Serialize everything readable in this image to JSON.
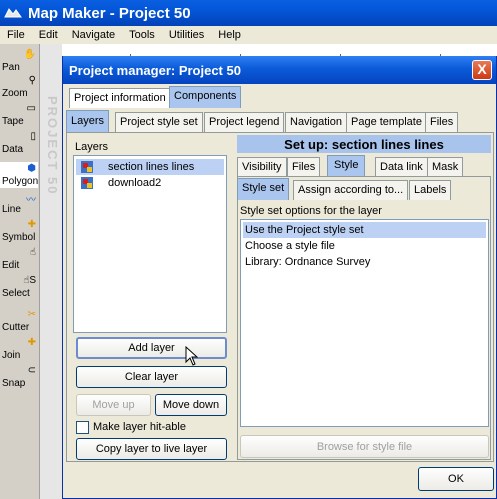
{
  "app": {
    "title": "Map Maker - Project 50",
    "menu": [
      "File",
      "Edit",
      "Navigate",
      "Tools",
      "Utilities",
      "Help"
    ],
    "side_watermark": "PROJECT 50"
  },
  "tools": [
    {
      "label": "Pan",
      "icon": "hand-icon"
    },
    {
      "label": "Zoom",
      "icon": "magnifier-icon"
    },
    {
      "label": "Tape",
      "icon": "tape-icon"
    },
    {
      "label": "Data",
      "icon": "data-icon"
    },
    {
      "label": "Polygon",
      "icon": "polygon-icon"
    },
    {
      "label": "Line",
      "icon": "line-icon"
    },
    {
      "label": "Symbol",
      "icon": "symbol-icon"
    },
    {
      "label": "Edit",
      "icon": "edit-icon"
    },
    {
      "label": "Select",
      "icon": "select-icon"
    },
    {
      "label": "Cutter",
      "icon": "cutter-icon"
    },
    {
      "label": "Join",
      "icon": "join-icon"
    },
    {
      "label": "Snap",
      "icon": "snap-icon"
    }
  ],
  "dialog": {
    "title": "Project manager: Project 50",
    "close_label": "X",
    "top_tabs": [
      "Project information",
      "Components"
    ],
    "second_tabs": [
      "Layers",
      "Project style set",
      "Project legend",
      "Navigation",
      "Page template",
      "Files"
    ],
    "layers_label": "Layers",
    "layers": [
      "section lines lines",
      "download2"
    ],
    "add_layer": "Add layer",
    "clear_layer": "Clear layer",
    "move_up": "Move up",
    "move_down": "Move down",
    "hit_able_label": "Make layer hit-able",
    "copy_live": "Copy layer to live layer",
    "setup_header": "Set up: section lines lines",
    "setup_tabs": [
      "Visibility",
      "Files",
      "Style",
      "Data link",
      "Mask"
    ],
    "style_tabs": [
      "Style set",
      "Assign according to...",
      "Labels"
    ],
    "style_options_label": "Style set options for the layer",
    "style_options": [
      "Use the Project style set",
      "Choose a style file",
      "Library: Ordnance Survey"
    ],
    "browse": "Browse for style file",
    "ok": "OK"
  }
}
